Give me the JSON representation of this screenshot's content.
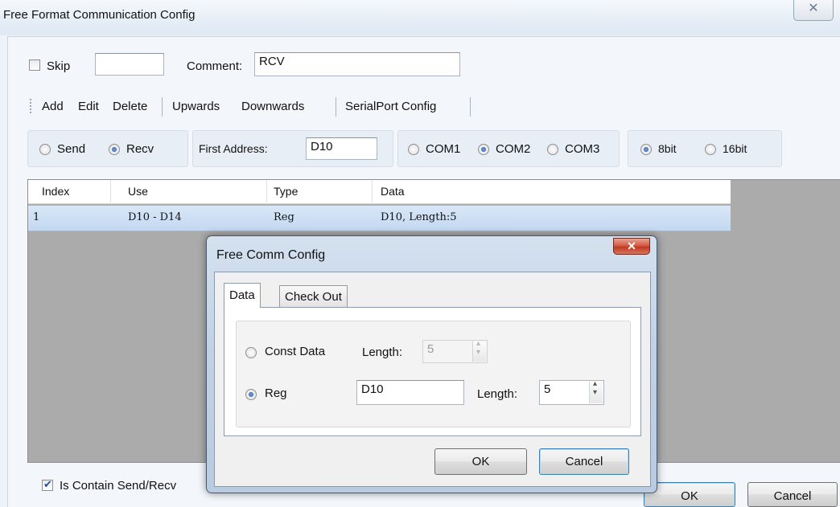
{
  "window": {
    "title": "Free Format Communication Config",
    "close_icon": "close-icon"
  },
  "top_row": {
    "skip_label": "Skip",
    "skip_checked": false,
    "skip_value": "",
    "comment_label": "Comment:",
    "comment_value": "RCV"
  },
  "toolbar": {
    "add": "Add",
    "edit": "Edit",
    "delete": "Delete",
    "upwards": "Upwards",
    "downwards": "Downwards",
    "serial_config": "SerialPort Config"
  },
  "options": {
    "send": "Send",
    "recv": "Recv",
    "direction_selected": "Recv",
    "first_address_label": "First Address:",
    "first_address_value": "D10",
    "com1": "COM1",
    "com2": "COM2",
    "com3": "COM3",
    "com_selected": "COM2",
    "bit8": "8bit",
    "bit16": "16bit",
    "bit_selected": "8bit"
  },
  "list": {
    "columns": [
      "Index",
      "Use",
      "Type",
      "Data"
    ],
    "rows": [
      {
        "index": "1",
        "use": "D10 - D14",
        "type": "Reg",
        "data": "D10, Length:5"
      }
    ]
  },
  "footer": {
    "contain_label": "Is Contain Send/Recv",
    "contain_checked": true,
    "ok": "OK",
    "cancel": "Cancel"
  },
  "dialog": {
    "title": "Free Comm Config",
    "close_icon": "close-icon",
    "tabs": [
      "Data",
      "Check Out"
    ],
    "active_tab": "Data",
    "const_label": "Const Data",
    "const_length_label": "Length:",
    "const_length_value": "5",
    "reg_label": "Reg",
    "reg_value": "D10",
    "reg_length_label": "Length:",
    "reg_length_value": "5",
    "selected": "Reg",
    "ok": "OK",
    "cancel": "Cancel"
  },
  "colors": {
    "selected_row": "#c9dcf3",
    "list_background": "#ababab",
    "dialog_close": "#c8452c"
  }
}
